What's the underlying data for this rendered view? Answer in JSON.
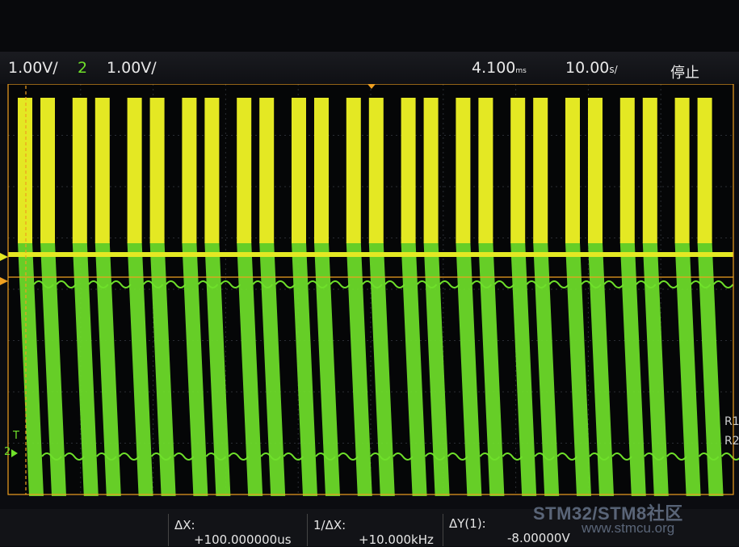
{
  "header": {
    "ch1_scale": "1.00V/",
    "ch2_number": "2",
    "ch2_scale": "1.00V/",
    "time_position": "4.100",
    "time_position_unit": "ms",
    "time_scale": "10.00",
    "time_scale_unit": "s/",
    "run_state": "停止"
  },
  "measurements": {
    "dx_label": "ΔX:",
    "dx_value": "+100.000000us",
    "inv_dx_label": "1/ΔX:",
    "inv_dx_value": "+10.000kHz",
    "dy_label": "ΔY(1):",
    "dy_value": "-8.00000V"
  },
  "side_labels": {
    "trigger_marker": "T",
    "ch2_marker": "2",
    "r1": "R1",
    "r2": "R2"
  },
  "watermark": {
    "title": "STM32/STM8社区",
    "url": "www.stmcu.org"
  },
  "colors": {
    "channel1": "#e4e823",
    "channel2": "#6fe02a",
    "cursor": "#f0a020",
    "screen_bg": "#0b0c10"
  },
  "waveform": {
    "burst_count": 14,
    "pulses_per_burst": 2
  }
}
